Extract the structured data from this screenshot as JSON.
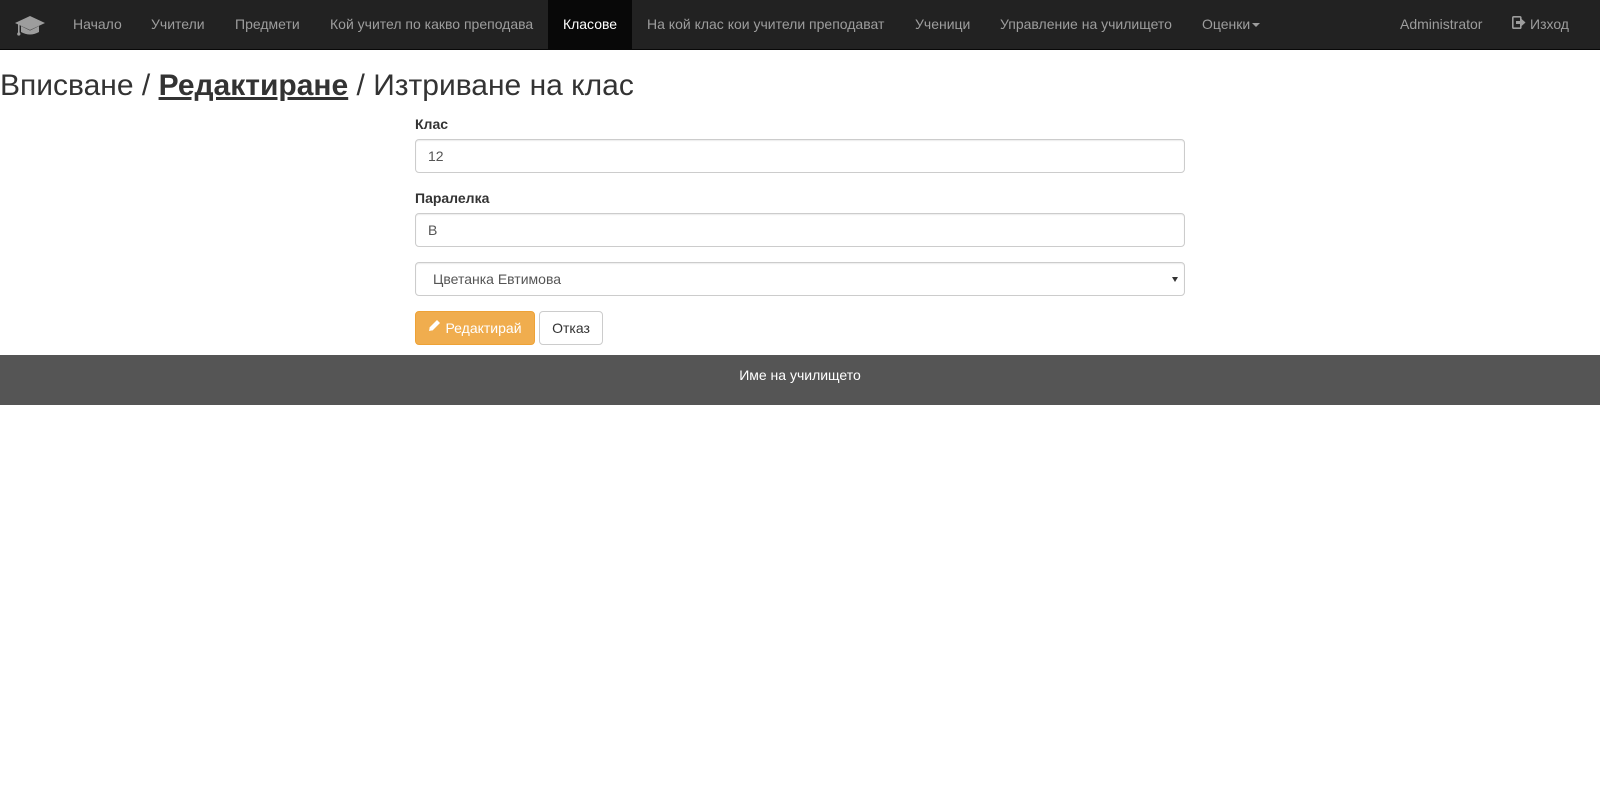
{
  "navbar": {
    "brand_icon": "graduation-cap-icon",
    "items": [
      {
        "label": "Начало"
      },
      {
        "label": "Учители"
      },
      {
        "label": "Предмети"
      },
      {
        "label": "Кой учител по какво преподава"
      },
      {
        "label": "Класове",
        "active": true
      },
      {
        "label": "На кой клас кои учители преподават"
      },
      {
        "label": "Ученици"
      },
      {
        "label": "Управление на училището"
      },
      {
        "label": "Оценки",
        "dropdown": true
      }
    ],
    "user_label": "Administrator",
    "logout_label": "Изход",
    "logout_icon": "log-out-icon",
    "colors": {
      "background": "#222222",
      "active_background": "#080808",
      "text": "#9d9d9d",
      "active_text": "#ffffff"
    }
  },
  "heading": {
    "part1": "Вписване / ",
    "part2": "Редактиране",
    "part3": " / Изтриване на клас"
  },
  "form": {
    "class_label": "Клас",
    "class_value": "12",
    "section_label": "Паралелка",
    "section_value": "В",
    "teacher_selected": "Цветанка Евтимова",
    "edit_button_label": "Редактирай",
    "edit_button_icon": "pencil-icon",
    "cancel_button_label": "Отказ",
    "colors": {
      "edit_button": "#f0ad4e"
    }
  },
  "footer": {
    "text": "Име на училището",
    "background": "#555555"
  }
}
